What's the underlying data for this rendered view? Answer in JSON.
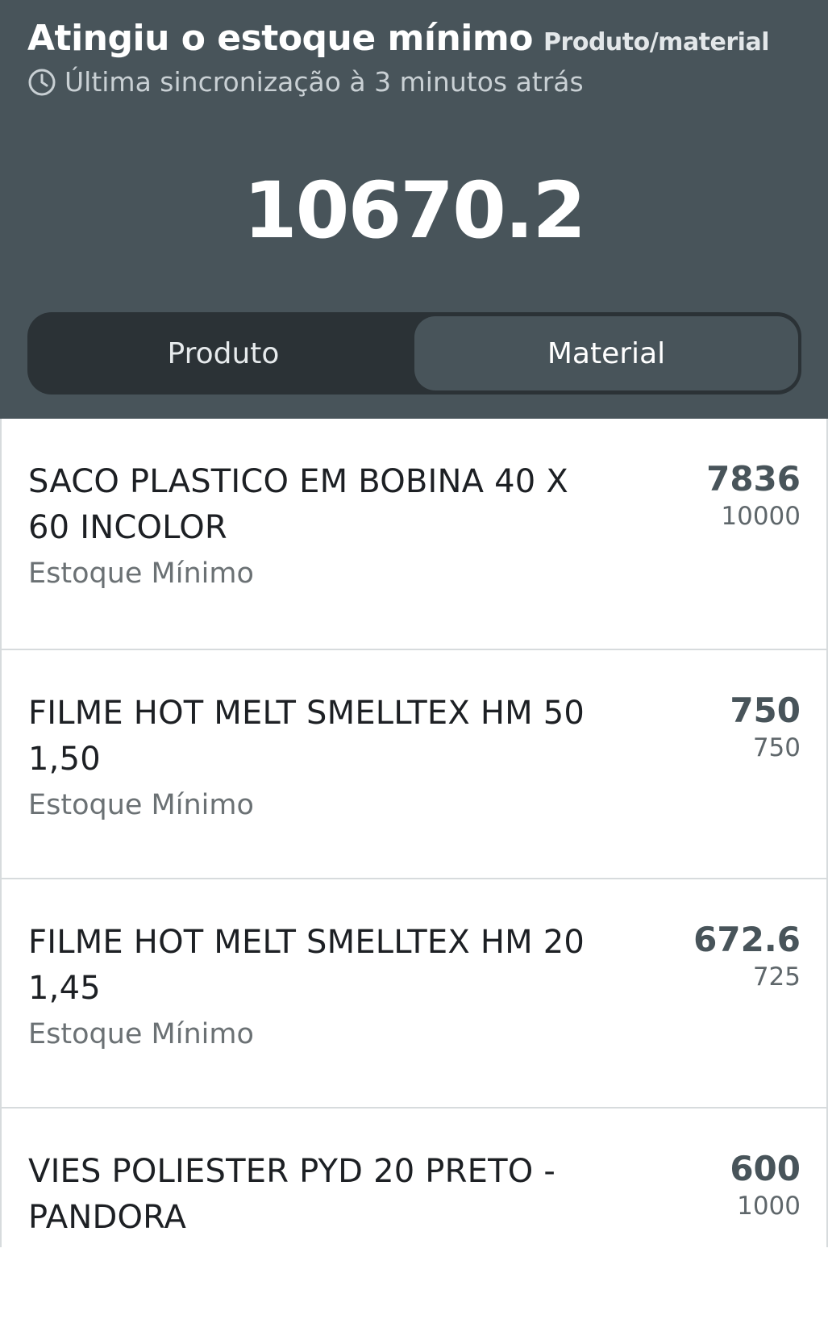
{
  "header": {
    "title": "Atingiu o estoque mínimo",
    "tag": "Produto/material",
    "sync_text": "Última sincronização à 3 minutos atrás",
    "sync_icon": "clock-icon",
    "total": "10670.2",
    "background_color": "#48545a"
  },
  "tabs": {
    "produto_label": "Produto",
    "material_label": "Material",
    "selected": "Material"
  },
  "items": [
    {
      "name": "SACO PLASTICO EM BOBINA 40 X 60 INCOLOR",
      "label": "Estoque Mínimo",
      "value": "7836",
      "minimum": "10000"
    },
    {
      "name": "FILME HOT MELT SMELLTEX HM 50 1,50",
      "label": "Estoque Mínimo",
      "value": "750",
      "minimum": "750"
    },
    {
      "name": "FILME HOT MELT SMELLTEX HM 20 1,45",
      "label": "Estoque Mínimo",
      "value": "672.6",
      "minimum": "725"
    },
    {
      "name": "VIES POLIESTER PYD 20 PRETO - PANDORA",
      "label": "",
      "value": "600",
      "minimum": "1000"
    }
  ]
}
